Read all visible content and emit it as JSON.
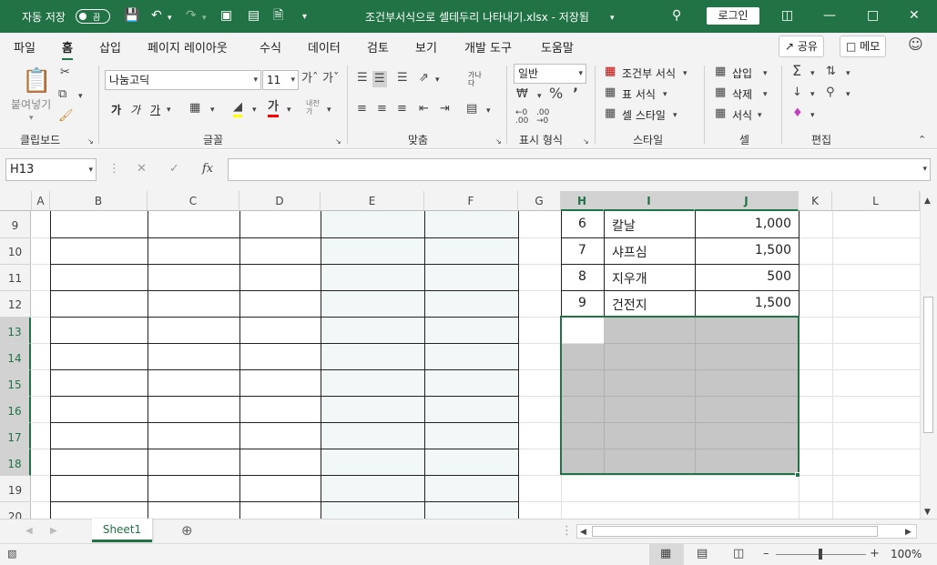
{
  "titlebar": {
    "autosave_label": "자동 저장",
    "autosave_state": "끔",
    "title": "조건부서식으로 셀테두리 나타내기.xlsx - 저장됨",
    "login_label": "로그인"
  },
  "menu": {
    "tabs": [
      "파일",
      "홈",
      "삽입",
      "페이지 레이아웃",
      "수식",
      "데이터",
      "검토",
      "보기",
      "개발 도구",
      "도움말"
    ],
    "active_tab": "홈",
    "share_label": "공유",
    "comment_label": "메모"
  },
  "ribbon": {
    "clipboard": {
      "paste_label": "붙여넣기",
      "group_label": "클립보드"
    },
    "font": {
      "font_name": "나눔고딕",
      "font_size": "11",
      "bold": "가",
      "italic": "가",
      "underline": "가",
      "group_label": "글꼴"
    },
    "alignment": {
      "group_label": "맞춤"
    },
    "number": {
      "format": "일반",
      "group_label": "표시 형식"
    },
    "styles": {
      "conditional_format": "조건부 서식",
      "format_as_table": "표 서식",
      "cell_styles": "셀 스타일",
      "group_label": "스타일"
    },
    "cells": {
      "insert": "삽입",
      "delete": "삭제",
      "format": "서식",
      "group_label": "셀"
    },
    "editing": {
      "group_label": "편집"
    }
  },
  "formula_bar": {
    "name_box": "H13",
    "fx_label": "fx",
    "value": ""
  },
  "grid": {
    "columns": [
      "A",
      "B",
      "C",
      "D",
      "E",
      "F",
      "G",
      "H",
      "I",
      "J",
      "K",
      "L"
    ],
    "rows": [
      "9",
      "10",
      "11",
      "12",
      "13",
      "14",
      "15",
      "16",
      "17",
      "18",
      "19",
      "20"
    ],
    "data_rows": [
      {
        "no": "6",
        "item": "칼날",
        "price": "1,000"
      },
      {
        "no": "7",
        "item": "샤프심",
        "price": "1,500"
      },
      {
        "no": "8",
        "item": "지우개",
        "price": "500"
      },
      {
        "no": "9",
        "item": "건전지",
        "price": "1,500"
      }
    ]
  },
  "sheet_tabs": {
    "active": "Sheet1"
  },
  "status": {
    "zoom": "100%"
  },
  "colors": {
    "brand": "#217346",
    "selection_fill": "#c6c6c6",
    "col_e_f_fill": "#f2f7f8"
  }
}
